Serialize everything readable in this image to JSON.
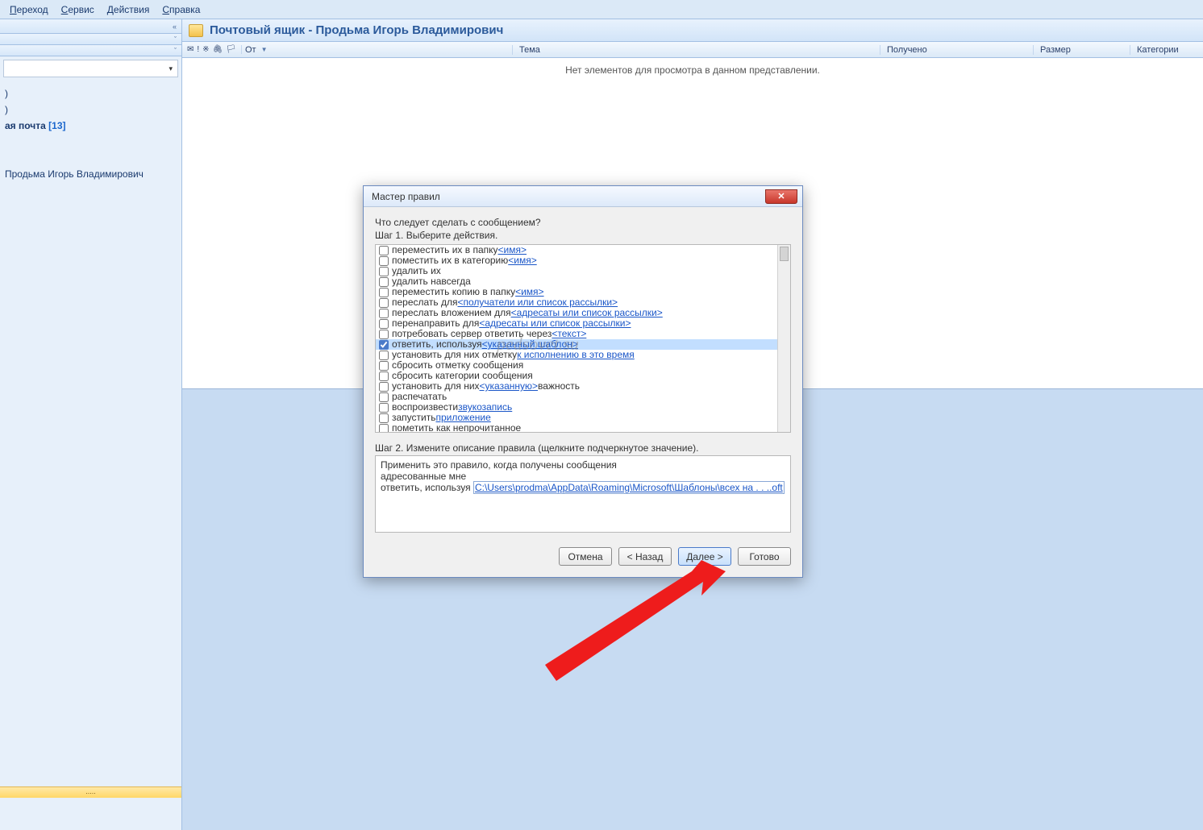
{
  "menu": {
    "go": "Переход",
    "service": "Сервис",
    "actions": "Действия",
    "help": "Справка"
  },
  "sidebar": {
    "inbox": "ая почта",
    "inbox_count": "[13]",
    "search_folder": "Продьма Игорь Владимирович",
    "dots": "....."
  },
  "content": {
    "title": "Почтовый ящик - Продьма Игорь Владимирович",
    "col_from": "От",
    "col_subject": "Тема",
    "col_received": "Получено",
    "col_size": "Размер",
    "col_category": "Категории",
    "empty": "Нет элементов для просмотра в данном представлении."
  },
  "dialog": {
    "title": "Мастер правил",
    "question": "Что следует сделать с сообщением?",
    "step1": "Шаг 1. Выберите действия.",
    "actions": [
      {
        "checked": false,
        "pre": "переместить их в папку ",
        "link": "<имя>"
      },
      {
        "checked": false,
        "pre": "поместить их в категорию ",
        "link": "<имя>"
      },
      {
        "checked": false,
        "pre": "удалить их",
        "link": ""
      },
      {
        "checked": false,
        "pre": "удалить навсегда",
        "link": ""
      },
      {
        "checked": false,
        "pre": "переместить копию в папку ",
        "link": "<имя>"
      },
      {
        "checked": false,
        "pre": "переслать для ",
        "link": "<получатели или список рассылки>"
      },
      {
        "checked": false,
        "pre": "переслать вложением для ",
        "link": "<адресаты или список рассылки>"
      },
      {
        "checked": false,
        "pre": "перенаправить для ",
        "link": "<адресаты или список рассылки>"
      },
      {
        "checked": false,
        "pre": "потребовать сервер ответить через ",
        "link": "<текст>"
      },
      {
        "checked": true,
        "pre": "ответить, используя ",
        "link": "<указанный шаблон>",
        "selected": true
      },
      {
        "checked": false,
        "pre": "установить для них отметку ",
        "link": "к исполнению в это время"
      },
      {
        "checked": false,
        "pre": "сбросить отметку сообщения",
        "link": ""
      },
      {
        "checked": false,
        "pre": "сбросить категории сообщения",
        "link": ""
      },
      {
        "checked": false,
        "pre": "установить для них ",
        "link": "<указанную>",
        "post": " важность"
      },
      {
        "checked": false,
        "pre": "распечатать",
        "link": ""
      },
      {
        "checked": false,
        "pre": "воспроизвести ",
        "link": "звукозапись"
      },
      {
        "checked": false,
        "pre": "запустить ",
        "link": "приложение"
      },
      {
        "checked": false,
        "pre": "пометить как непрочитанное",
        "link": ""
      }
    ],
    "step2": "Шаг 2. Измените описание правила (щелкните подчеркнутое значение).",
    "desc_line1": "Применить это правило, когда получены сообщения",
    "desc_line2": "адресованные мне",
    "desc_line3_pre": "ответить, используя ",
    "desc_line3_link": "C:\\Users\\prodma\\AppData\\Roaming\\Microsoft\\Шаблоны\\всех на . . ..oft",
    "btn_cancel": "Отмена",
    "btn_back": "< Назад",
    "btn_next": "Далее >",
    "btn_finish": "Готово"
  },
  "watermark": "pedsovet.su"
}
